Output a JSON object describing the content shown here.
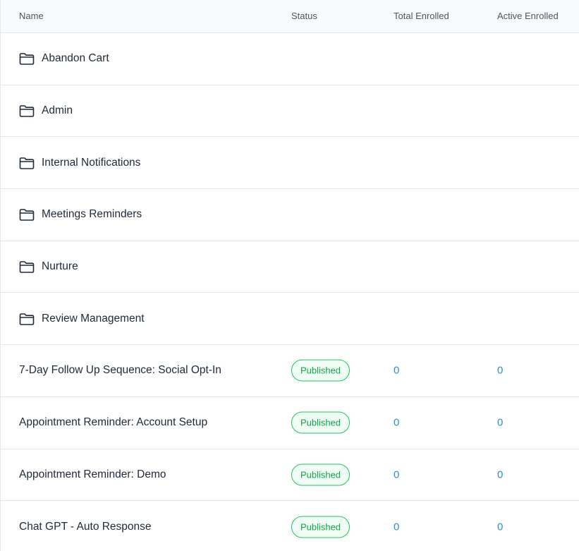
{
  "columns": {
    "name": "Name",
    "status": "Status",
    "total": "Total Enrolled",
    "active": "Active Enrolled"
  },
  "folders": [
    {
      "label": "Abandon Cart"
    },
    {
      "label": "Admin"
    },
    {
      "label": "Internal Notifications"
    },
    {
      "label": "Meetings Reminders"
    },
    {
      "label": "Nurture"
    },
    {
      "label": "Review Management"
    }
  ],
  "workflows": [
    {
      "name": "7-Day Follow Up Sequence: Social Opt-In",
      "status": "Published",
      "total": "0",
      "active": "0"
    },
    {
      "name": "Appointment Reminder: Account Setup",
      "status": "Published",
      "total": "0",
      "active": "0"
    },
    {
      "name": "Appointment Reminder: Demo",
      "status": "Published",
      "total": "0",
      "active": "0"
    },
    {
      "name": "Chat GPT - Auto Response",
      "status": "Published",
      "total": "0",
      "active": "0"
    }
  ],
  "colors": {
    "published_border": "#22c55e",
    "published_text": "#16a34a",
    "link_number": "#2b8fd9"
  },
  "icons": {
    "folder": "folder-icon"
  }
}
